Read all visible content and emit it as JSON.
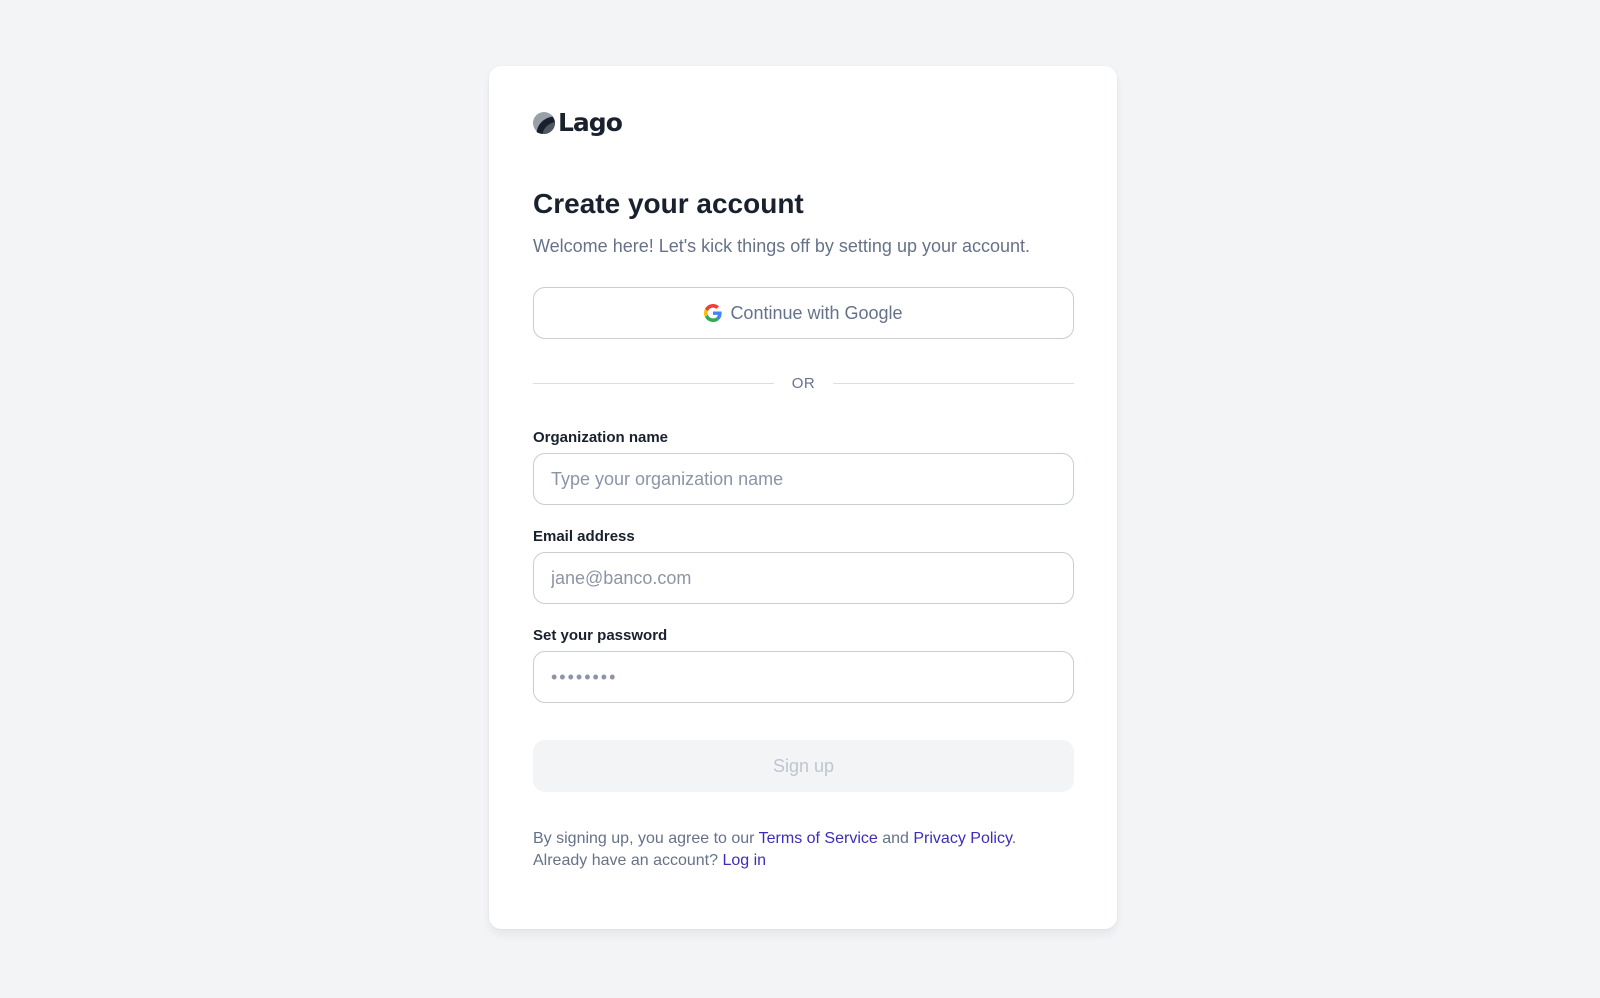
{
  "brand": {
    "name": "Lago"
  },
  "header": {
    "title": "Create your account",
    "subtitle": "Welcome here! Let's kick things off by setting up your account."
  },
  "google_button": {
    "label": "Continue with Google",
    "icon": "google-g-icon"
  },
  "divider": {
    "label": "OR"
  },
  "form": {
    "organization": {
      "label": "Organization name",
      "placeholder": "Type your organization name",
      "value": ""
    },
    "email": {
      "label": "Email address",
      "placeholder": "jane@banco.com",
      "value": ""
    },
    "password": {
      "label": "Set your password",
      "placeholder": "••••••••",
      "value": ""
    },
    "submit_label": "Sign up",
    "submit_disabled": true
  },
  "footer": {
    "agree_prefix": "By signing up, you agree to our ",
    "terms_label": "Terms of Service",
    "and_text": " and ",
    "privacy_label": "Privacy Policy",
    "period": ".",
    "login_prefix": "Already have an account? ",
    "login_label": "Log in"
  },
  "colors": {
    "background": "#f3f4f6",
    "card": "#ffffff",
    "text_primary": "#19212e",
    "text_secondary": "#66728a",
    "link": "#3b2dbd",
    "border": "#c8ccd4",
    "button_disabled_bg": "#f3f4f6",
    "button_disabled_text": "#bfc5cf"
  }
}
